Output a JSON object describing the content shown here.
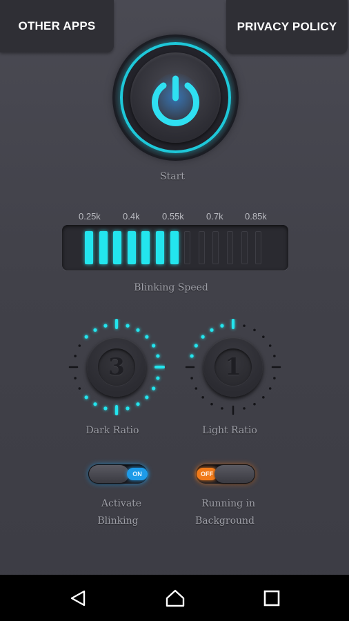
{
  "header": {
    "other_apps_label": "OTHER APPS",
    "privacy_policy_label": "PRIVACY POLICY"
  },
  "power": {
    "icon": "power-icon",
    "label": "Start",
    "accent_color": "#1ec8d9"
  },
  "speed": {
    "label": "Blinking Speed",
    "ticks": [
      "0.25k",
      "0.4k",
      "0.55k",
      "0.7k",
      "0.85k"
    ],
    "total_bars": 13,
    "active_bars": 7,
    "active_color": "#23e5ee"
  },
  "dark_ratio": {
    "label": "Dark Ratio",
    "value": "3"
  },
  "light_ratio": {
    "label": "Light Ratio",
    "value": "1"
  },
  "toggles": {
    "activate": {
      "label_line1": "Activate",
      "label_line2": "Blinking",
      "state": "ON",
      "color": "#1e9be8"
    },
    "background": {
      "label_line1": "Running in",
      "label_line2": "Background",
      "state": "OFF",
      "color": "#f07a1a"
    }
  },
  "navbar": {
    "back_icon": "back-triangle-icon",
    "home_icon": "home-icon",
    "recents_icon": "recents-square-icon"
  }
}
